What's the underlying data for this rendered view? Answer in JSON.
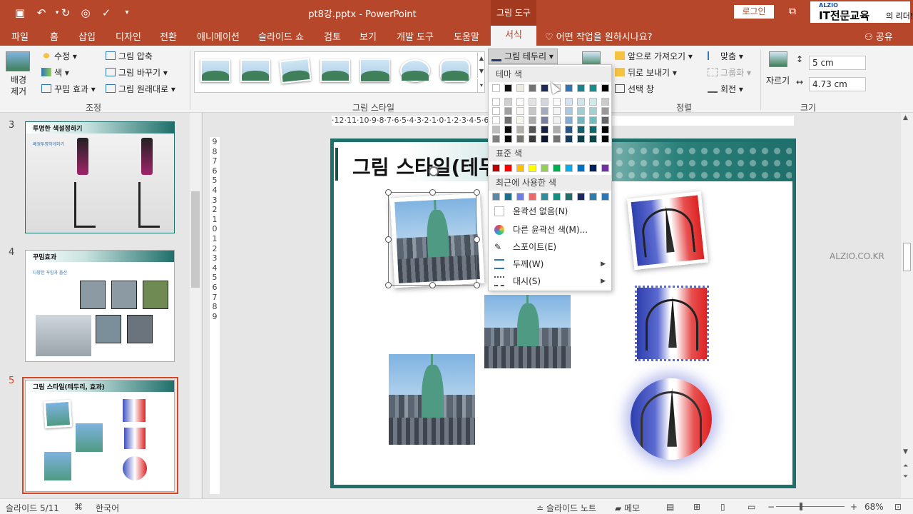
{
  "app": {
    "doc_title": "pt8강.pptx  -  PowerPoint",
    "context_tab_header": "그림 도구",
    "login": "로그인",
    "brand": {
      "top": "ALZIO",
      "main": "IT전문교육",
      "tail": "의 리더!"
    }
  },
  "tabs": [
    {
      "label": "파일"
    },
    {
      "label": "홈"
    },
    {
      "label": "삽입"
    },
    {
      "label": "디자인"
    },
    {
      "label": "전환"
    },
    {
      "label": "애니메이션"
    },
    {
      "label": "슬라이드 쇼"
    },
    {
      "label": "검토"
    },
    {
      "label": "보기"
    },
    {
      "label": "개발 도구"
    },
    {
      "label": "도움말"
    }
  ],
  "active_tab": "서식",
  "tell_me": "어떤 작업을 원하시나요?",
  "share": "공유",
  "ribbon": {
    "remove_bg": "배경 제거",
    "adjust": {
      "corrections": "수정",
      "color": "색",
      "artistic": "꾸밈 효과",
      "compress": "그림 압축",
      "change": "그림 바꾸기",
      "reset": "그림 원래대로",
      "label": "조정"
    },
    "styles_label": "그림 스타일",
    "border_button": "그림 테두리",
    "arrange": {
      "bring_forward": "앞으로 가져오기",
      "send_backward": "뒤로 보내기",
      "selection_pane": "선택 창",
      "align": "맞춤",
      "group": "그룹화",
      "rotate": "회전",
      "label": "정렬"
    },
    "size": {
      "crop": "자르기",
      "height": "5 cm",
      "width": "4.73 cm",
      "label": "크기"
    }
  },
  "border_dropdown": {
    "theme_colors_header": "테마 색",
    "standard_colors_header": "표준 색",
    "recent_colors_header": "최근에 사용한 색",
    "theme_colors": [
      "#ffffff",
      "#111111",
      "#eeece1",
      "#737373",
      "#1f2a5c",
      "#e7e6e6",
      "#2e75b6",
      "#1f7f8c",
      "#138f8f",
      "#000000"
    ],
    "standard_colors": [
      "#c00000",
      "#ff0000",
      "#ffc000",
      "#ffff00",
      "#92d050",
      "#00b050",
      "#00b0f0",
      "#0070c0",
      "#002060",
      "#7030a0"
    ],
    "recent_colors": [
      "#5b87a8",
      "#1f6f8c",
      "#6c7fe6",
      "#e86a6a",
      "#2a8f9f",
      "#138f7f",
      "#1f6f6a",
      "#1f2a5c",
      "#2a7fae",
      "#2e75b6"
    ],
    "no_outline": "윤곽선 없음(N)",
    "more_colors": "다른 윤곽선 색(M)...",
    "eyedropper": "스포이트(E)",
    "weight": "두께(W)",
    "dashes": "대시(S)"
  },
  "thumbnails": [
    {
      "num": "3",
      "title": "투명한 색설정하기",
      "sub": "배경투명하게하기"
    },
    {
      "num": "4",
      "title": "꾸밈효과",
      "sub": "다양한 꾸밈과 옵션"
    },
    {
      "num": "5",
      "title": "그림 스타일(테두리, 효과)"
    }
  ],
  "slide": {
    "title": "그림 스타일(테두리, 효과)"
  },
  "watermark": "ALZIO.CO.KR",
  "rulers": {
    "horizontal": "·12·11·10·9·8·7·6·5·4·3·2·1·0·1·2·3·4·5·6·7·8·9·10·11·12·",
    "vertical": [
      "9",
      "8",
      "7",
      "6",
      "5",
      "4",
      "3",
      "2",
      "1",
      "0",
      "1",
      "2",
      "3",
      "4",
      "5",
      "6",
      "7",
      "8",
      "9"
    ]
  },
  "status": {
    "slide_info": "슬라이드 5/11",
    "language": "한국어",
    "notes": "슬라이드 노트",
    "comments": "메모",
    "zoom": "68%"
  }
}
